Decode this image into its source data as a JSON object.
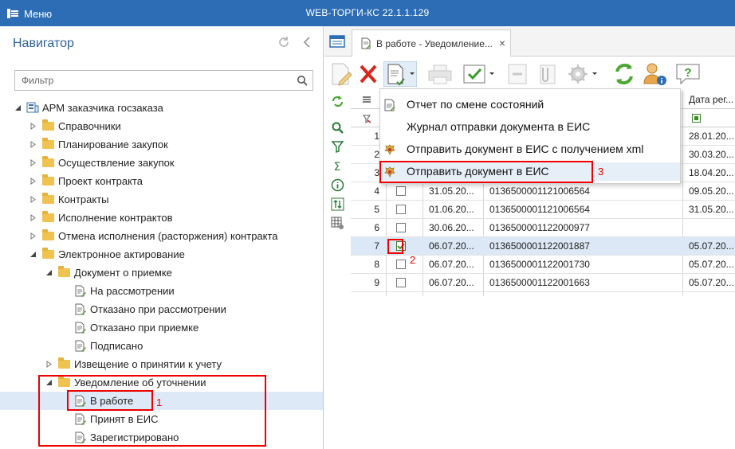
{
  "window": {
    "menu_label": "Меню",
    "app_title": "WEB-ТОРГИ-КС 22.1.1.129"
  },
  "navigator": {
    "title": "Навигатор",
    "filter_placeholder": "Фильтр",
    "root": "АРМ заказчика госзаказа",
    "items": [
      {
        "label": "Справочники"
      },
      {
        "label": "Планирование закупок"
      },
      {
        "label": "Осуществление закупок"
      },
      {
        "label": "Проект контракта"
      },
      {
        "label": "Контракты"
      },
      {
        "label": "Исполнение контрактов"
      },
      {
        "label": "Отмена исполнения (расторжения) контракта"
      },
      {
        "label": "Электронное актирование"
      },
      {
        "label": "Документ о приемке"
      },
      {
        "label": "На рассмотрении"
      },
      {
        "label": "Отказано при рассмотрении"
      },
      {
        "label": "Отказано при приемке"
      },
      {
        "label": "Подписано"
      },
      {
        "label": "Извещение о принятии к учету"
      },
      {
        "label": "Уведомление об уточнении"
      },
      {
        "label": "В работе"
      },
      {
        "label": "Принят в ЕИС"
      },
      {
        "label": "Зарегистрировано"
      }
    ]
  },
  "annotations": {
    "one": "1",
    "two": "2",
    "three": "3"
  },
  "tab": {
    "label": "В работе - Уведомление...",
    "close": "×"
  },
  "grid": {
    "last_header": "Дата рег...",
    "rows": [
      {
        "n": "1",
        "checked": false,
        "date": "",
        "num": "",
        "reg": "28.01.20..."
      },
      {
        "n": "2",
        "checked": false,
        "date": "",
        "num": "",
        "reg": "30.03.20..."
      },
      {
        "n": "3",
        "checked": false,
        "date": "",
        "num": "",
        "reg": "18.04.20..."
      },
      {
        "n": "4",
        "checked": false,
        "date": "31.05.20...",
        "num": "0136500001121006564",
        "reg": "09.05.20..."
      },
      {
        "n": "5",
        "checked": false,
        "date": "01.06.20...",
        "num": "0136500001121006564",
        "reg": "31.05.20..."
      },
      {
        "n": "6",
        "checked": false,
        "date": "30.06.20...",
        "num": "0136500001122000977",
        "reg": ""
      },
      {
        "n": "7",
        "checked": true,
        "date": "06.07.20...",
        "num": "0136500001122001887",
        "reg": "05.07.20..."
      },
      {
        "n": "8",
        "checked": false,
        "date": "06.07.20...",
        "num": "0136500001122001730",
        "reg": "05.07.20..."
      },
      {
        "n": "9",
        "checked": false,
        "date": "06.07.20...",
        "num": "0136500001122001663",
        "reg": "05.07.20..."
      }
    ]
  },
  "dropdown": {
    "items": [
      {
        "label": "Отчет по смене состояний"
      },
      {
        "label": "Журнал отправки документа в ЕИС"
      },
      {
        "label": "Отправить документ в ЕИС с получением xml"
      },
      {
        "label": "Отправить документ в ЕИС"
      }
    ]
  },
  "colors": {
    "accent": "#2d6db5",
    "highlight": "#e00000",
    "selection": "#dde9f7"
  }
}
